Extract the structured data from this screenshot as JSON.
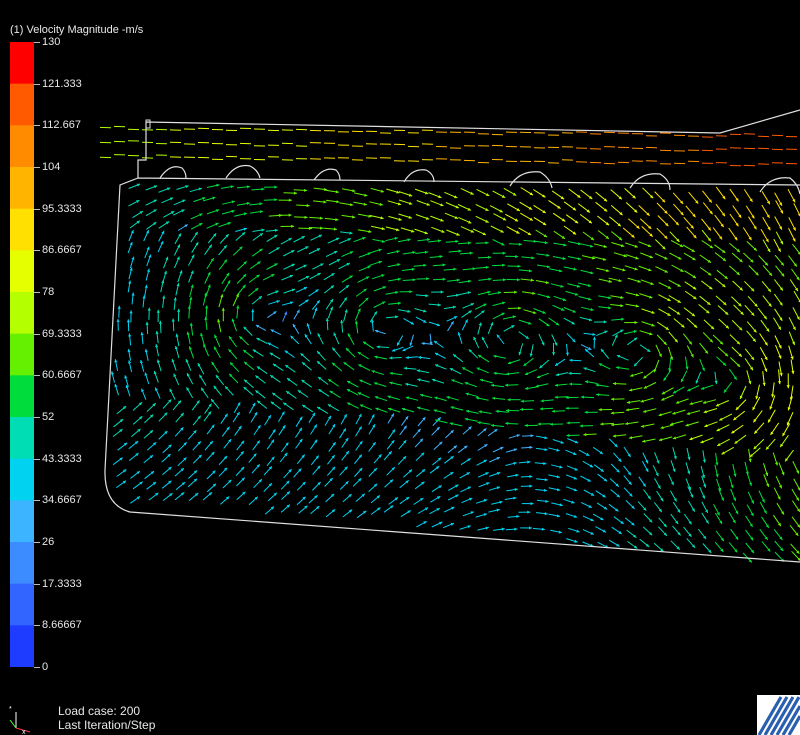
{
  "legend": {
    "title": "(1) Velocity Magnitude -m/s",
    "ticks": [
      "130",
      "121.333",
      "112.667",
      "104",
      "95.3333",
      "86.6667",
      "78",
      "69.3333",
      "60.6667",
      "52",
      "43.3333",
      "34.6667",
      "26",
      "17.3333",
      "8.66667",
      "0"
    ],
    "colors": [
      "#ff0000",
      "#ff5a00",
      "#ff8c00",
      "#ffb400",
      "#ffe000",
      "#e6ff00",
      "#b4ff00",
      "#64f000",
      "#00dc3c",
      "#00dcb4",
      "#00d2f0",
      "#3cb4ff",
      "#3c8cff",
      "#3264ff",
      "#1e3cff",
      "#0000ff"
    ]
  },
  "status": {
    "load_case": "Load case: 200",
    "iteration": "Last Iteration/Step"
  },
  "triad": {
    "icon": "coordinate-triad-icon"
  },
  "logo": {
    "icon": "software-logo-icon"
  }
}
